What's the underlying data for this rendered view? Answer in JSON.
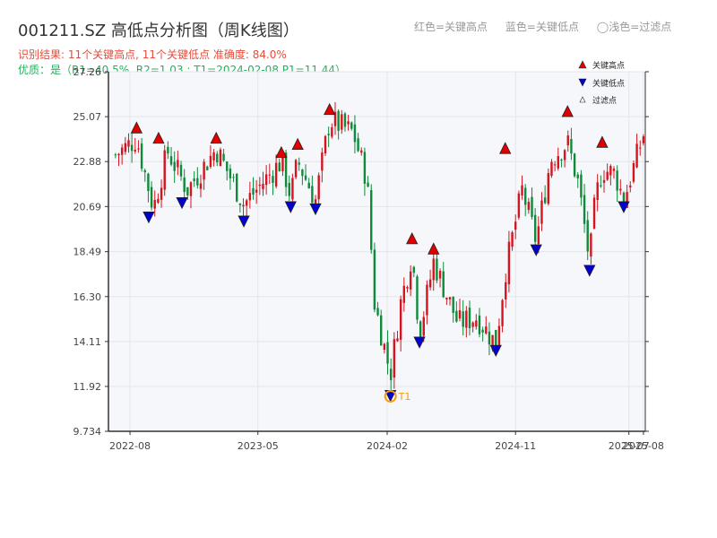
{
  "header": {
    "title": "001211.SZ 高低点分析图（周K线图）",
    "legend_top": [
      "红色=关键高点",
      "蓝色=关键低点",
      "◯浅色=过滤点"
    ],
    "result": "识别结果: 11个关键高点, 11个关键低点   准确度: 84.0%",
    "quality": "优质：是（R1=40.5%, R2=1.03 ; T1=2024-02-08 P1=11.44）"
  },
  "legend_box": {
    "items": [
      {
        "label": "关键高点",
        "color": "#e00000"
      },
      {
        "label": "关键低点",
        "color": "#0000d0"
      },
      {
        "label": "过滤点",
        "color": "#ffffff"
      }
    ]
  },
  "colors": {
    "up": "#d4141e",
    "down": "#0e8a3a",
    "high": "#e00000",
    "low": "#0000d0",
    "t1": "#f39c12",
    "plot_bg": "#f5f7fa"
  },
  "chart_data": {
    "type": "candlestick",
    "ylim": [
      9.734,
      27.26
    ],
    "y_ticks": [
      9.734,
      11.92,
      14.11,
      16.3,
      18.49,
      20.69,
      22.88,
      25.07,
      27.26
    ],
    "x_range": [
      "2022-07-01",
      "2025-08-01"
    ],
    "x_ticks": [
      {
        "date": "2022-08-01",
        "label": "2022-08"
      },
      {
        "date": "2023-05-01",
        "label": "2023-05"
      },
      {
        "date": "2024-02-01",
        "label": "2024-02"
      },
      {
        "date": "2024-11-01",
        "label": "2024-11"
      },
      {
        "date": "2025-07-01",
        "label": "2025-07"
      },
      {
        "date": "2025-08-01",
        "label": "2025-08"
      }
    ],
    "anchors": [
      {
        "date": "2022-07-01",
        "close": 23.2
      },
      {
        "date": "2022-08-15",
        "close": 24.0
      },
      {
        "date": "2022-09-20",
        "close": 20.6
      },
      {
        "date": "2022-10-20",
        "close": 23.4
      },
      {
        "date": "2022-12-01",
        "close": 21.5
      },
      {
        "date": "2023-02-01",
        "close": 23.5
      },
      {
        "date": "2023-04-01",
        "close": 20.8
      },
      {
        "date": "2023-06-20",
        "close": 22.9
      },
      {
        "date": "2023-07-10",
        "close": 21.2
      },
      {
        "date": "2023-07-25",
        "close": 22.9
      },
      {
        "date": "2023-09-01",
        "close": 21.0
      },
      {
        "date": "2023-10-01",
        "close": 24.9
      },
      {
        "date": "2023-11-20",
        "close": 24.3
      },
      {
        "date": "2023-12-20",
        "close": 22.0
      },
      {
        "date": "2024-01-05",
        "close": 16.0
      },
      {
        "date": "2024-02-08",
        "close": 12.5
      },
      {
        "date": "2024-03-01",
        "close": 16.0
      },
      {
        "date": "2024-03-25",
        "close": 18.4
      },
      {
        "date": "2024-04-10",
        "close": 14.5
      },
      {
        "date": "2024-05-10",
        "close": 18.0
      },
      {
        "date": "2024-07-01",
        "close": 15.0
      },
      {
        "date": "2024-08-10",
        "close": 15.3
      },
      {
        "date": "2024-09-20",
        "close": 14.0
      },
      {
        "date": "2024-10-10",
        "close": 17.5
      },
      {
        "date": "2024-11-15",
        "close": 21.5
      },
      {
        "date": "2024-12-15",
        "close": 19.0
      },
      {
        "date": "2025-01-15",
        "close": 23.0
      },
      {
        "date": "2025-02-20",
        "close": 23.8
      },
      {
        "date": "2025-03-15",
        "close": 21.8
      },
      {
        "date": "2025-04-08",
        "close": 18.0
      },
      {
        "date": "2025-04-20",
        "close": 21.0
      },
      {
        "date": "2025-05-05",
        "close": 22.5
      },
      {
        "date": "2025-06-01",
        "close": 22.3
      },
      {
        "date": "2025-06-20",
        "close": 21.0
      },
      {
        "date": "2025-08-01",
        "close": 24.2
      }
    ],
    "key_highs": [
      {
        "date": "2022-08-15",
        "value": 24.1
      },
      {
        "date": "2022-10-01",
        "value": 23.6
      },
      {
        "date": "2023-02-01",
        "value": 23.6
      },
      {
        "date": "2023-06-20",
        "value": 22.9
      },
      {
        "date": "2023-07-25",
        "value": 23.3
      },
      {
        "date": "2023-10-01",
        "value": 25.0
      },
      {
        "date": "2024-03-25",
        "value": 18.7
      },
      {
        "date": "2024-05-10",
        "value": 18.2
      },
      {
        "date": "2024-10-10",
        "value": 23.1
      },
      {
        "date": "2025-02-20",
        "value": 24.9
      },
      {
        "date": "2025-05-05",
        "value": 23.4
      }
    ],
    "key_lows": [
      {
        "date": "2022-09-10",
        "value": 20.6
      },
      {
        "date": "2022-11-20",
        "value": 21.3
      },
      {
        "date": "2023-04-01",
        "value": 20.4
      },
      {
        "date": "2023-07-10",
        "value": 21.1
      },
      {
        "date": "2023-09-01",
        "value": 21.0
      },
      {
        "date": "2024-02-08",
        "value": 11.9
      },
      {
        "date": "2024-04-10",
        "value": 14.5
      },
      {
        "date": "2024-09-20",
        "value": 14.1
      },
      {
        "date": "2024-12-15",
        "value": 19.0
      },
      {
        "date": "2025-04-08",
        "value": 18.0
      },
      {
        "date": "2025-06-20",
        "value": 21.1
      }
    ],
    "t1": {
      "date": "2024-02-08",
      "value": 11.44,
      "label": "T1"
    }
  }
}
